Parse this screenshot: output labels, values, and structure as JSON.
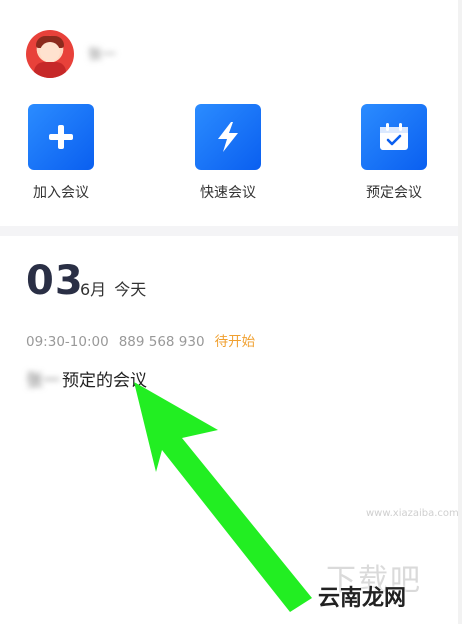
{
  "profile": {
    "name": "张一"
  },
  "actions": [
    {
      "label": "加入会议",
      "icon": "plus-icon"
    },
    {
      "label": "快速会议",
      "icon": "lightning-icon"
    },
    {
      "label": "预定会议",
      "icon": "calendar-check-icon"
    }
  ],
  "meeting_day": {
    "day": "03",
    "month": "6月",
    "relative": "今天"
  },
  "meeting": {
    "time": "09:30-10:00",
    "id": "889 568 930",
    "status": "待开始",
    "owner": "张一",
    "title": "预定的会议"
  },
  "watermark": {
    "text": "云南龙网",
    "ghost": "下载吧",
    "site": "www.xiazaiba.com"
  },
  "colors": {
    "accent": "#0a5ff0",
    "status": "#f0a030",
    "arrow": "#22ee22"
  }
}
